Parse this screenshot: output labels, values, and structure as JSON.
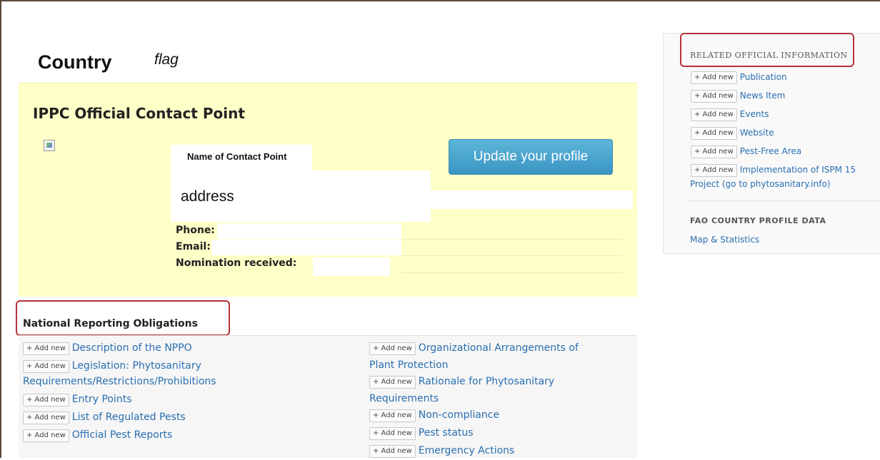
{
  "header": {
    "title": "Country",
    "flag_label": "flag"
  },
  "contact": {
    "title": "IPPC Official Contact Point",
    "name_label": "Name of Contact Point",
    "address": "address",
    "update_button": "Update your profile",
    "fields": [
      "Phone:",
      "Email:",
      "Nomination received:"
    ]
  },
  "nro": {
    "title": "National Reporting Obligations",
    "add_label": "+ Add new",
    "left": [
      [
        "Description of the NPPO"
      ],
      [
        "Legislation: Phytosanitary",
        "Requirements/Restrictions/Prohibitions"
      ],
      [
        "Entry Points"
      ],
      [
        "List of Regulated Pests"
      ],
      [
        "Official Pest Reports"
      ]
    ],
    "right": [
      [
        "Organizational Arrangements of",
        "Plant Protection"
      ],
      [
        "Rationale for Phytosanitary",
        "Requirements"
      ],
      [
        "Non-compliance"
      ],
      [
        "Pest status"
      ],
      [
        "Emergency Actions"
      ]
    ]
  },
  "sidebar": {
    "related_title": "RELATED OFFICIAL INFORMATION",
    "add_label": "+ Add new",
    "items": [
      "Publication",
      "News Item",
      "Events",
      "Website",
      "Pest-Free Area",
      "Implementation of ISPM 15"
    ],
    "project_link": "Project (go to phytosanitary.info)",
    "fao_title": "FAO COUNTRY PROFILE DATA",
    "map_link": "Map & Statistics"
  }
}
